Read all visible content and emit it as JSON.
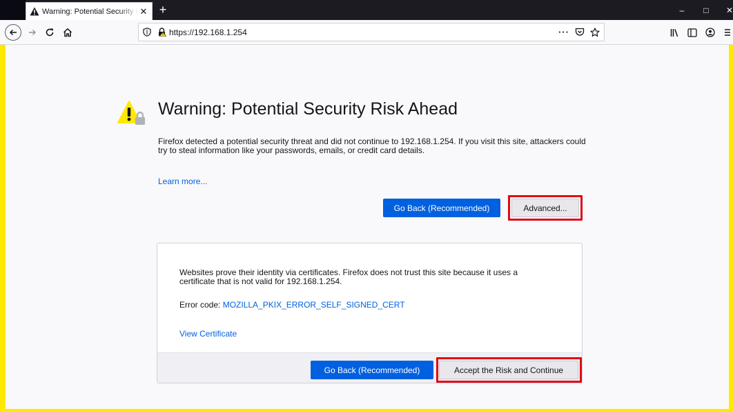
{
  "browser": {
    "tab": {
      "title": "Warning: Potential Security Risk Ahead",
      "close_icon": "close-icon",
      "icon": "warning-triangle-icon"
    },
    "new_tab_label": "+",
    "window_controls": {
      "minimize": "‒",
      "maximize": "□",
      "close": "✕"
    },
    "nav": {
      "back_icon": "back-arrow-icon",
      "forward_icon": "forward-arrow-icon",
      "reload_icon": "reload-icon",
      "home_icon": "home-icon"
    },
    "urlbar": {
      "url": "https://192.168.1.254",
      "shield_icon": "tracking-shield-icon",
      "lock_icon": "insecure-lock-icon",
      "page_actions_label": "···",
      "pocket_icon": "pocket-icon",
      "bookmark_icon": "star-icon"
    },
    "toolbar_right": [
      "library-icon",
      "sidebar-icon",
      "account-icon",
      "menu-icon"
    ]
  },
  "error_page": {
    "title": "Warning: Potential Security Risk Ahead",
    "description": "Firefox detected a potential security threat and did not continue to 192.168.1.254. If you visit this site, attackers could try to steal information like your passwords, emails, or credit card details.",
    "learn_more": "Learn more...",
    "go_back_label": "Go Back (Recommended)",
    "advanced_label": "Advanced...",
    "advanced_panel": {
      "text": "Websites prove their identity via certificates. Firefox does not trust this site because it uses a certificate that is not valid for 192.168.1.254.",
      "error_code_label": "Error code:",
      "error_code": "MOZILLA_PKIX_ERROR_SELF_SIGNED_CERT",
      "view_certificate": "View Certificate",
      "go_back_label": "Go Back (Recommended)",
      "accept_label": "Accept the Risk and Continue"
    }
  },
  "colors": {
    "accent_blue": "#0060df",
    "highlight_red": "#e20612",
    "border_yellow": "#ffe900",
    "warning_yellow": "#ffe900"
  }
}
